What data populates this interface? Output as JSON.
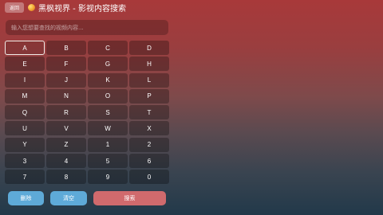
{
  "header": {
    "back_label": "返回",
    "title": "黑枫视界 - 影视内容搜索",
    "logo_icon": "maple-logo-icon"
  },
  "search": {
    "placeholder": "输入您想要查找的视频内容...",
    "value": ""
  },
  "keyboard": {
    "selected_key": "A",
    "keys": [
      "A",
      "B",
      "C",
      "D",
      "E",
      "F",
      "G",
      "H",
      "I",
      "J",
      "K",
      "L",
      "M",
      "N",
      "O",
      "P",
      "Q",
      "R",
      "S",
      "T",
      "U",
      "V",
      "W",
      "X",
      "Y",
      "Z",
      "1",
      "2",
      "3",
      "4",
      "5",
      "6",
      "7",
      "8",
      "9",
      "0"
    ]
  },
  "actions": {
    "delete_label": "删除",
    "clear_label": "清空",
    "search_label": "搜索"
  },
  "colors": {
    "action_blue": "#5eaad8",
    "action_red": "#d06a6d",
    "bg_top": "#a8393a",
    "bg_bottom": "#22394a"
  }
}
